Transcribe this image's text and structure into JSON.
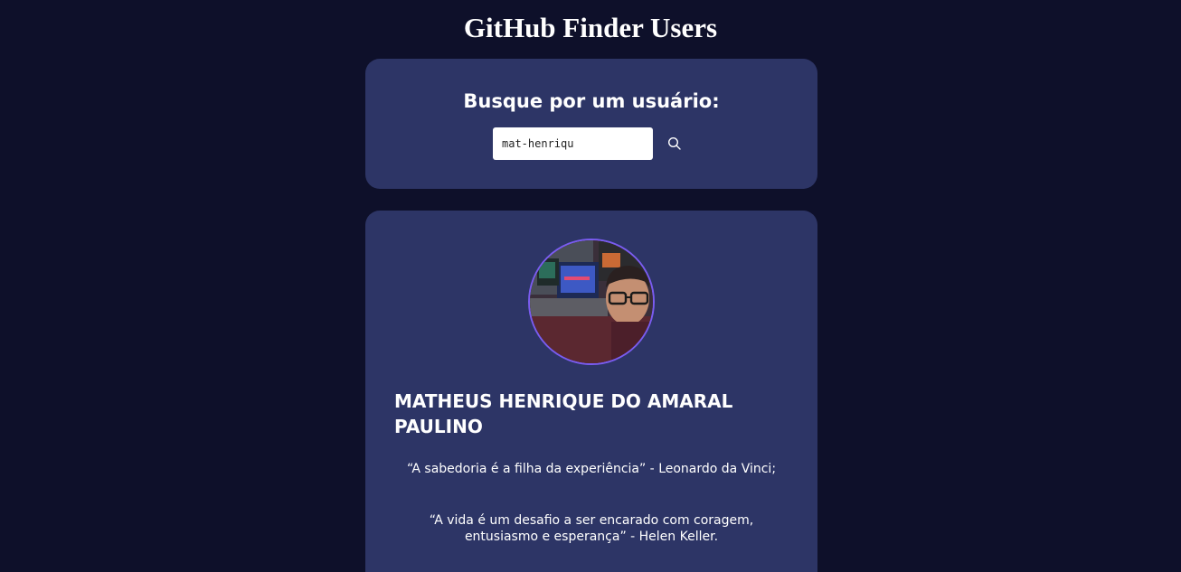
{
  "header": {
    "title": "GitHub Finder Users"
  },
  "search": {
    "heading": "Busque por um usuário:",
    "input_value": "mat-henriqu",
    "button_icon": "search-icon"
  },
  "profile": {
    "avatar_icon": "avatar",
    "name": "MATHEUS HENRIQUE DO AMARAL PAULINO",
    "bio_line_1": "“A sabedoria é a filha da experiência” - Leonardo da Vinci;",
    "bio_line_2a": "“A vida é um desafio a ser encarado com coragem,",
    "bio_line_2b": "entusiasmo e esperança” - Helen Keller."
  },
  "colors": {
    "background": "#0e102a",
    "card": "#2d3566",
    "avatar_border": "#7a5cf0",
    "text": "#ffffff"
  }
}
